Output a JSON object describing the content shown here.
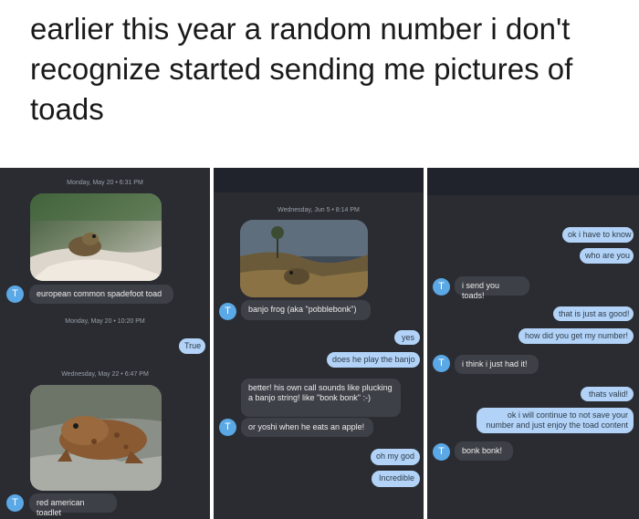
{
  "caption": "earlier this year a random number i don't recognize started sending me pictures of toads",
  "panel1": {
    "timestamp1": "Monday, May 20 • 6:31 PM",
    "sender_initial": "T",
    "msg1": "european common spadefoot toad",
    "timestamp2": "Monday, May 20 • 10:20 PM",
    "reply1": "True",
    "timestamp3": "Wednesday, May 22 • 6:47 PM",
    "msg2": "red american toadlet"
  },
  "panel2": {
    "timestamp1": "Wednesday, Jun 5 • 8:14 PM",
    "sender_initial": "T",
    "msg1": "banjo frog (aka \"pobblebonk\")",
    "reply1": "yes",
    "reply2": "does he play the banjo",
    "msg2": "better! his own call sounds like plucking a banjo string! like \"bonk bonk\" :-)",
    "msg3": "or yoshi when he eats an apple!",
    "reply3": "oh my god",
    "reply4": "Incredible"
  },
  "panel3": {
    "sender_initial": "T",
    "reply1": "ok i have to know",
    "reply2": "who are you",
    "msg1": "i send you toads!",
    "reply3": "that is just as good!",
    "reply4": "how did you get my number!",
    "msg2": "i think i just had it!",
    "reply5": "thats valid!",
    "reply6": "ok i will continue to not save your number and just enjoy the toad content",
    "msg3": "bonk bonk!"
  },
  "colors": {
    "panel_bg": "#2a2c32",
    "incoming_bubble": "#3d4047",
    "outgoing_bubble": "#b2d3f7",
    "avatar": "#5aa8e6"
  }
}
